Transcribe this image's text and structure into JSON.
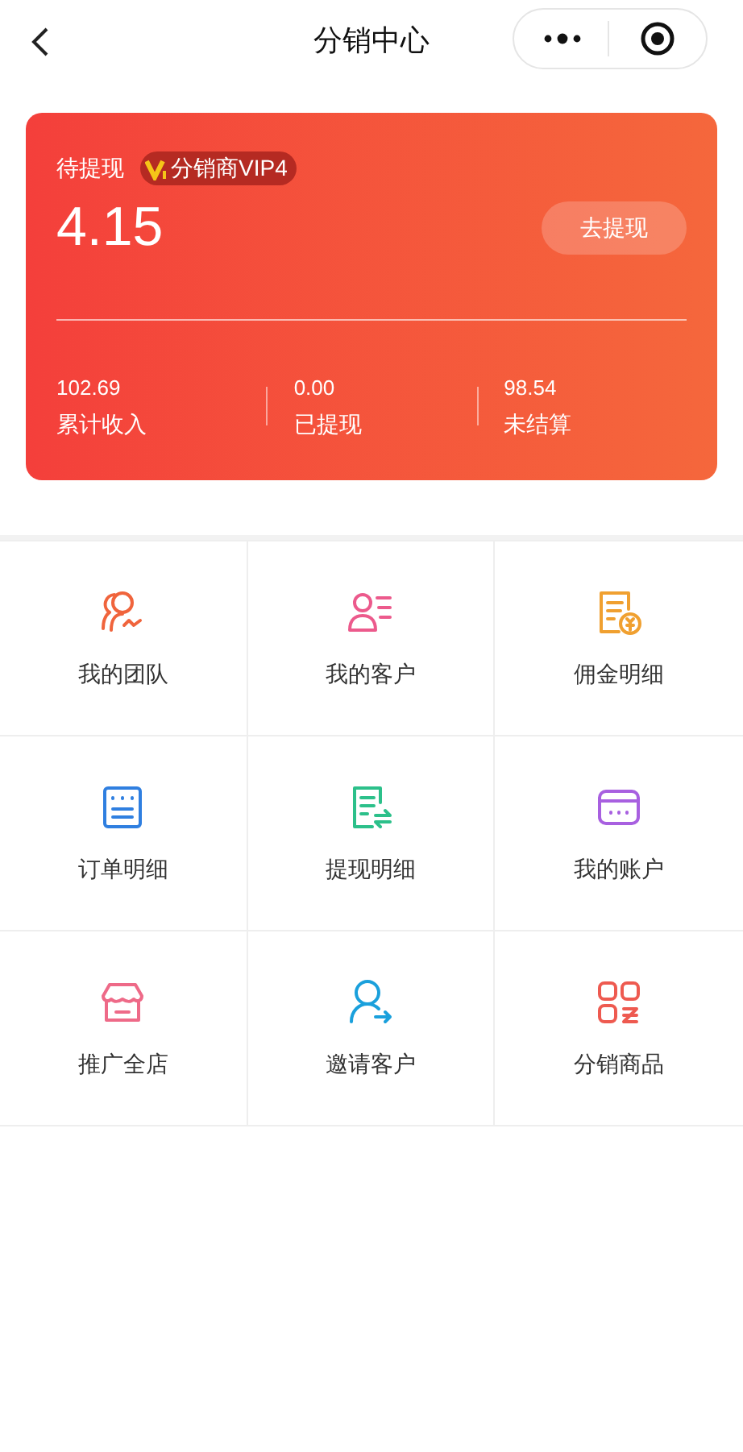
{
  "nav": {
    "title": "分销中心"
  },
  "balance_card": {
    "label": "待提现",
    "badge": "分销商VIP4",
    "amount": "4.15",
    "withdraw_button": "去提现",
    "stats": [
      {
        "value": "102.69",
        "label": "累计收入"
      },
      {
        "value": "0.00",
        "label": "已提现"
      },
      {
        "value": "98.54",
        "label": "未结算"
      }
    ]
  },
  "menu": [
    {
      "label": "我的团队",
      "color": "#f0643c"
    },
    {
      "label": "我的客户",
      "color": "#ec5a8c"
    },
    {
      "label": "佣金明细",
      "color": "#f0a030"
    },
    {
      "label": "订单明细",
      "color": "#2f7fe0"
    },
    {
      "label": "提现明细",
      "color": "#2cc08a"
    },
    {
      "label": "我的账户",
      "color": "#a860e0"
    },
    {
      "label": "推广全店",
      "color": "#ee6a88"
    },
    {
      "label": "邀请客户",
      "color": "#1aa0dc"
    },
    {
      "label": "分销商品",
      "color": "#ee5a50"
    }
  ]
}
